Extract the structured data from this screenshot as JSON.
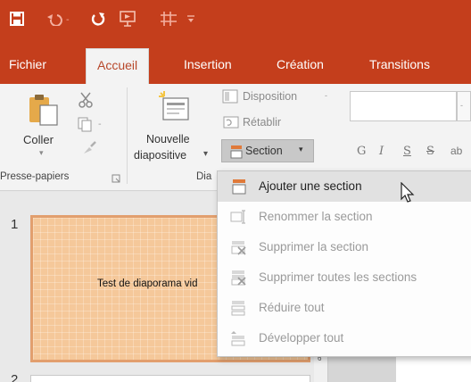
{
  "colors": {
    "accent": "#c43e1c",
    "ribbon": "#f3f3f3",
    "slide_fill": "#f5c89a"
  },
  "quick_access": {
    "icons": [
      "save-icon",
      "undo-icon",
      "redo-icon",
      "present-icon",
      "table-icon",
      "customize-icon"
    ]
  },
  "tabs": [
    {
      "label": "Fichier"
    },
    {
      "label": "Accueil"
    },
    {
      "label": "Insertion"
    },
    {
      "label": "Création"
    },
    {
      "label": "Transitions"
    }
  ],
  "ribbon": {
    "clipboard": {
      "paste_label": "Coller",
      "group_label": "Presse-papiers"
    },
    "slides": {
      "new_slide_line1": "Nouvelle",
      "new_slide_line2": "diapositive",
      "layout_label": "Disposition",
      "reset_label": "Rétablir",
      "section_label": "Section",
      "group_label": "Dia"
    },
    "font": {
      "bold": "G",
      "italic": "I",
      "underline": "S",
      "strike": "S",
      "more": "ab"
    }
  },
  "slides": [
    {
      "number": "1",
      "text": "Test de diaporama vid"
    },
    {
      "number": "2"
    }
  ],
  "section_menu": {
    "items": [
      {
        "label": "Ajouter une section",
        "enabled": true,
        "icon": "add-section-icon"
      },
      {
        "label": "Renommer la section",
        "enabled": false,
        "icon": "rename-section-icon"
      },
      {
        "label": "Supprimer la section",
        "enabled": false,
        "icon": "remove-section-icon"
      },
      {
        "label": "Supprimer toutes les sections",
        "enabled": false,
        "icon": "remove-all-sections-icon"
      },
      {
        "label": "Réduire tout",
        "enabled": false,
        "icon": "collapse-all-icon"
      },
      {
        "label": "Développer tout",
        "enabled": false,
        "icon": "expand-all-icon"
      }
    ]
  }
}
